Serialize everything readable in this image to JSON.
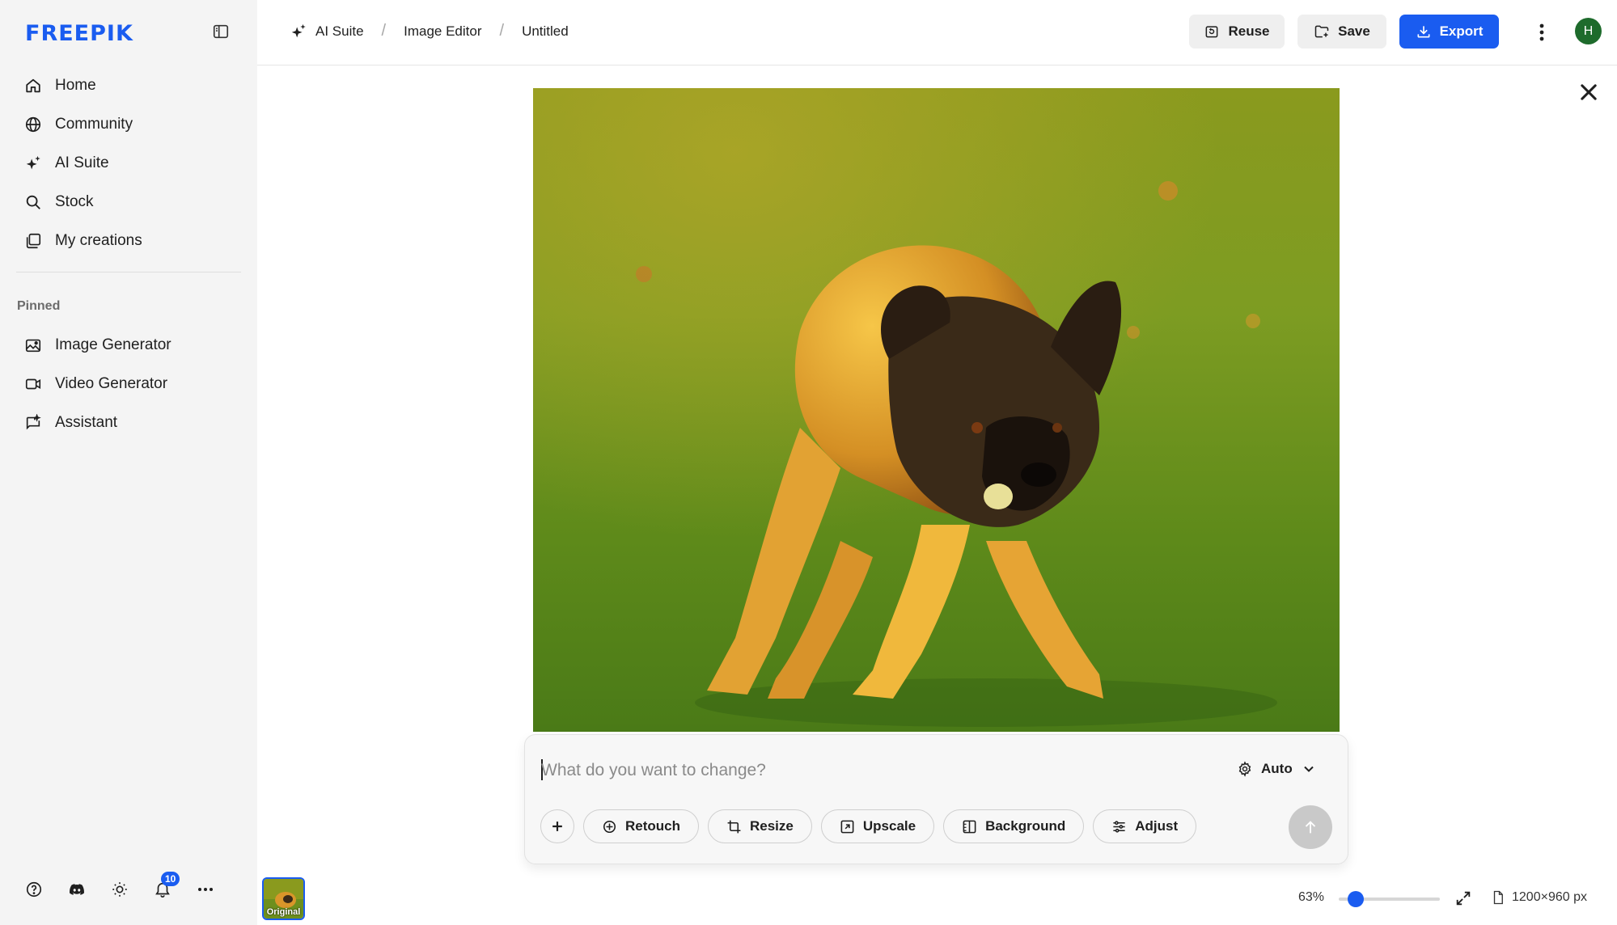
{
  "app": {
    "logo": "FREEPIK"
  },
  "sidebar": {
    "items": [
      {
        "label": "Home",
        "icon": "home-icon"
      },
      {
        "label": "Community",
        "icon": "globe-icon"
      },
      {
        "label": "AI Suite",
        "icon": "sparkles-icon"
      },
      {
        "label": "Stock",
        "icon": "search-icon"
      },
      {
        "label": "My creations",
        "icon": "stack-icon"
      }
    ],
    "pinned_label": "Pinned",
    "pinned": [
      {
        "label": "Image Generator",
        "icon": "image-icon"
      },
      {
        "label": "Video Generator",
        "icon": "video-icon"
      },
      {
        "label": "Assistant",
        "icon": "chat-icon"
      }
    ],
    "notifications_count": "10"
  },
  "header": {
    "breadcrumbs": [
      "AI Suite",
      "Image Editor",
      "Untitled"
    ],
    "reuse_label": "Reuse",
    "save_label": "Save",
    "export_label": "Export",
    "avatar_initial": "H"
  },
  "prompt": {
    "placeholder": "What do you want to change?",
    "mode": "Auto",
    "tools": [
      "Retouch",
      "Resize",
      "Upscale",
      "Background",
      "Adjust"
    ]
  },
  "footer": {
    "thumbnail_label": "Original",
    "zoom": "63%",
    "zoom_fraction": 0.1,
    "dimensions": "1200×960 px"
  },
  "colors": {
    "accent": "#1a5cf0",
    "sidebar_bg": "#f4f4f4",
    "avatar_bg": "#1e6b2c"
  }
}
